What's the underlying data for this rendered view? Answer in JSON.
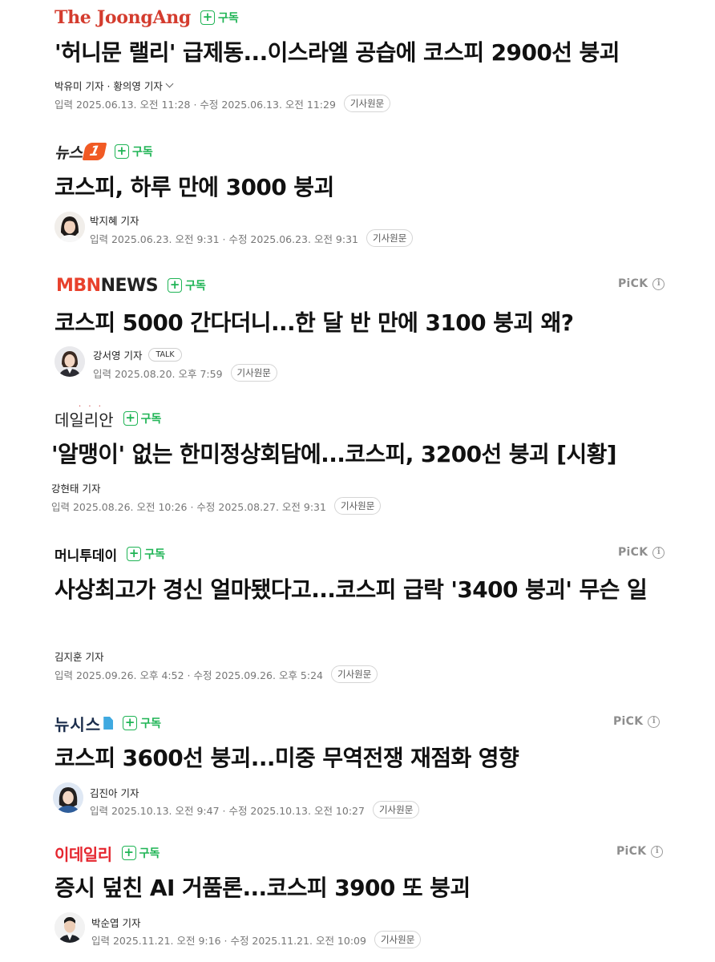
{
  "subscribe_label": "구독",
  "subscribe_plus": "+",
  "pick_label": "PiCK",
  "pick_info": "i",
  "original_button": "기사원문",
  "articles": [
    {
      "press": "The JoongAng",
      "headline": "'허니문 랠리' 급제동...이스라엘 공습에 코스피 2900선 붕괴",
      "reporter": "박유미 기자 · 황의영 기자",
      "dates": "입력 2025.06.13. 오전 11:28 · 수정 2025.06.13. 오전 11:29"
    },
    {
      "press": "뉴스",
      "press_badge": "1",
      "headline": "코스피, 하루 만에 3000 붕괴",
      "reporter": "박지혜 기자",
      "dates": "입력 2025.06.23. 오전 9:31 · 수정 2025.06.23. 오전 9:31"
    },
    {
      "press_part1": "MBN",
      "press_part2": "NEWS",
      "headline": "코스피 5000 간다더니...한 달 반 만에 3100 붕괴 왜?",
      "reporter": "강서영 기자",
      "talk": "TALK",
      "dates": "입력 2025.08.20. 오후 7:59"
    },
    {
      "press": "데일리안",
      "headline": "'알맹이' 없는 한미정상회담에...코스피, 3200선 붕괴 [시황]",
      "reporter": "강현태 기자",
      "dates": "입력 2025.08.26. 오전 10:26 · 수정 2025.08.27. 오전 9:31"
    },
    {
      "press": "머니투데이",
      "headline": "사상최고가 경신 얼마됐다고...코스피 급락 '3400 붕괴' 무슨 일",
      "reporter": "김지훈 기자",
      "dates": "입력 2025.09.26. 오후 4:52 · 수정 2025.09.26. 오후 5:24"
    },
    {
      "press": "뉴시스",
      "headline": "코스피 3600선 붕괴...미중 무역전쟁 재점화 영향",
      "reporter": "김진아 기자",
      "dates": "입력 2025.10.13. 오전 9:47 · 수정 2025.10.13. 오전 10:27"
    },
    {
      "press": "이데일리",
      "headline": "증시 덮친 AI 거품론...코스피 3900 또 붕괴",
      "reporter": "박순엽 기자",
      "dates": "입력 2025.11.21. 오전 9:16 · 수정 2025.11.21. 오전 10:09"
    }
  ]
}
